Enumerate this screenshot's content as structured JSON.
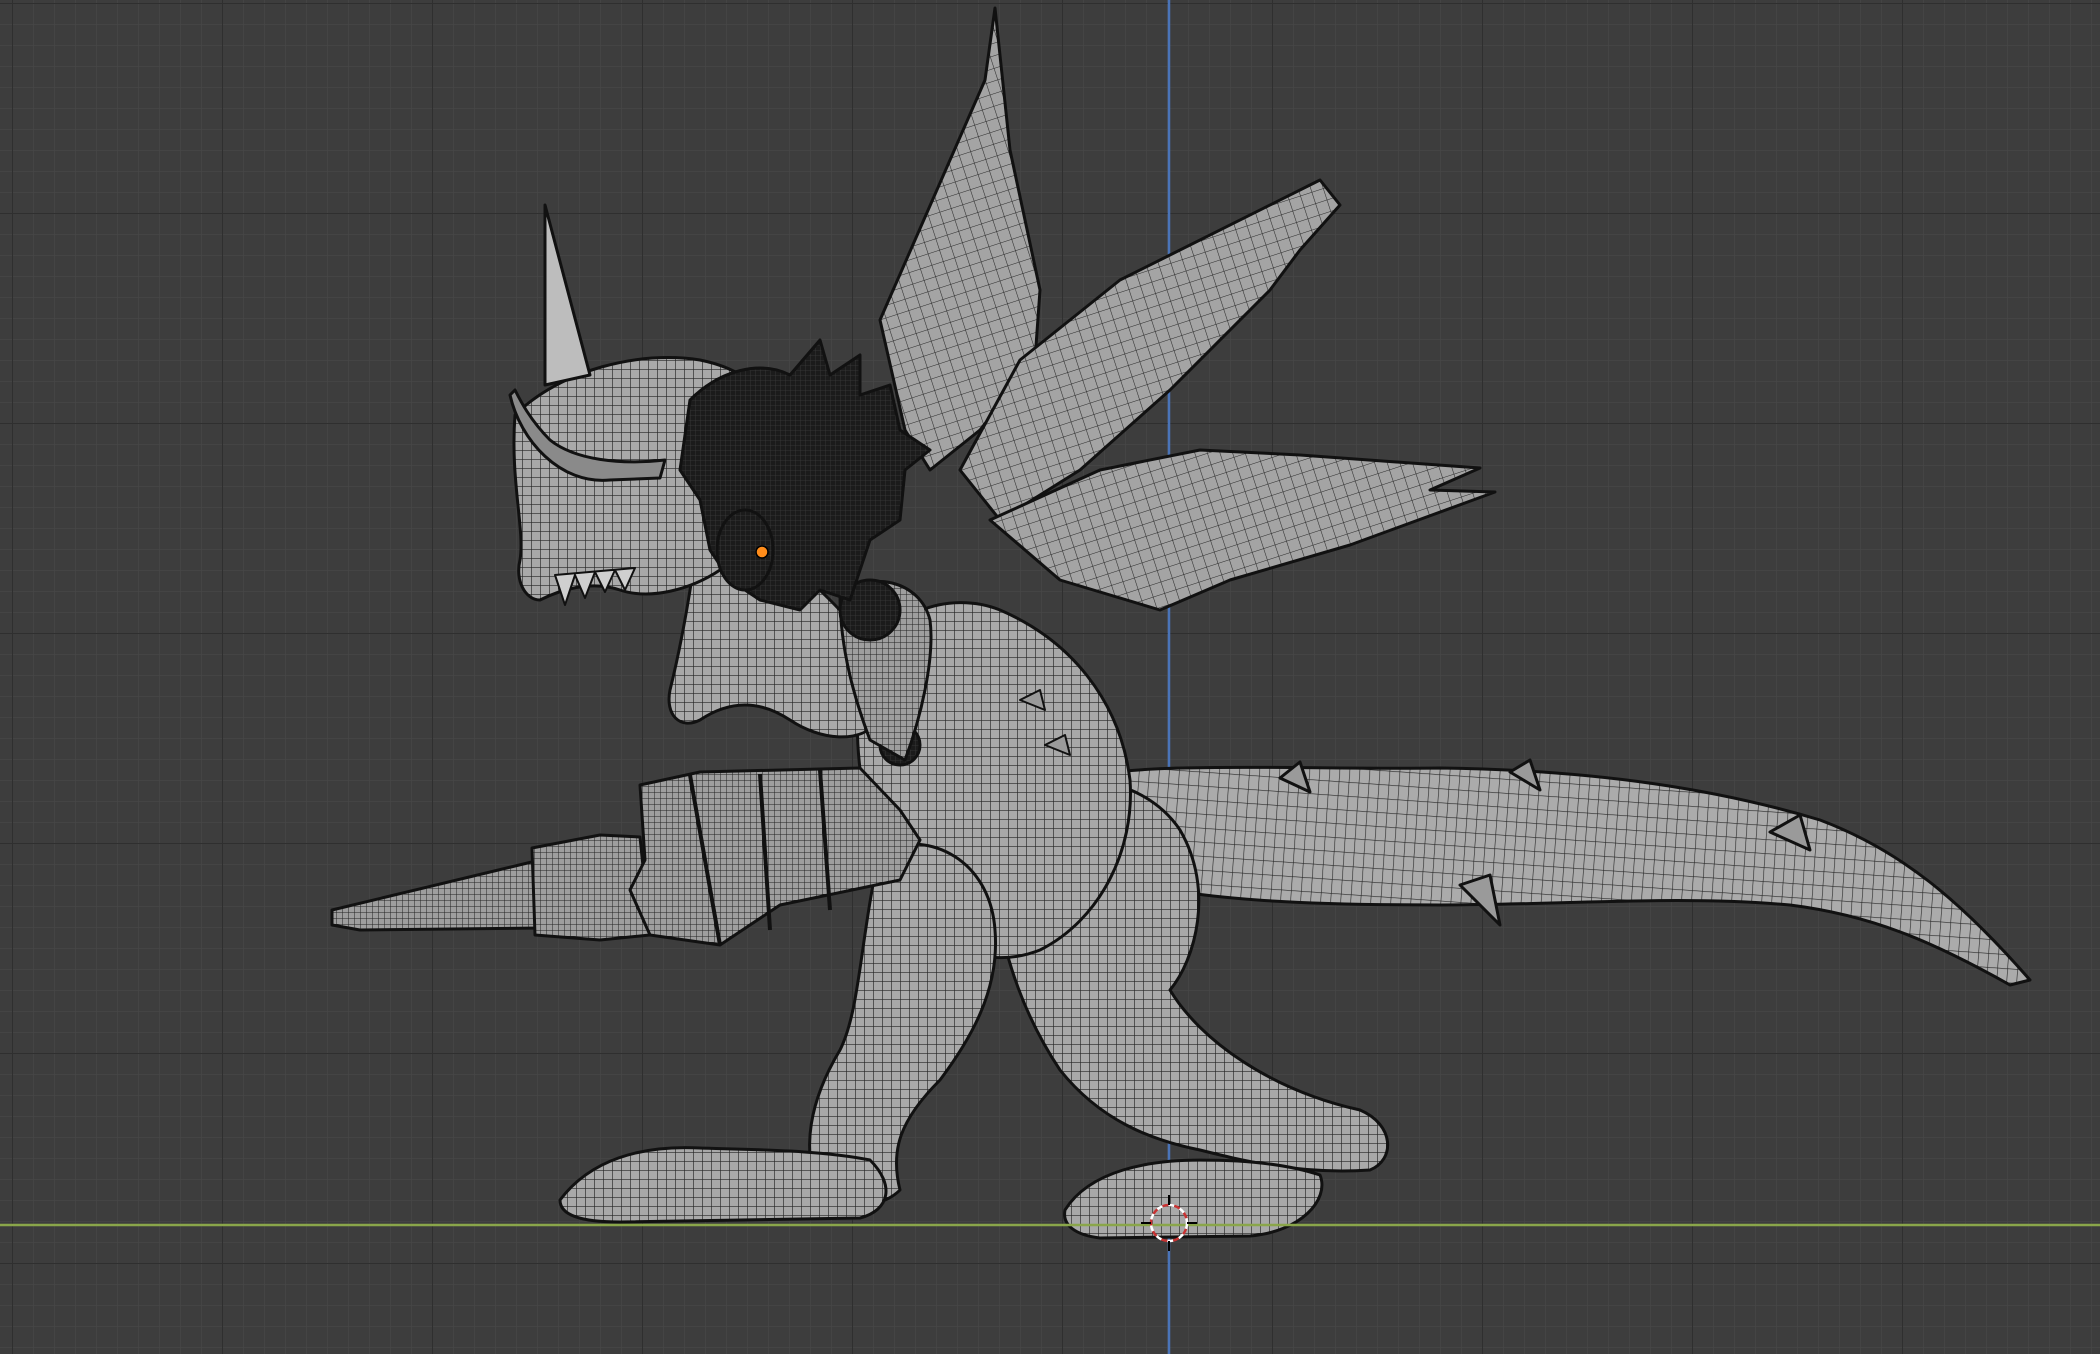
{
  "viewport": {
    "label": "",
    "background_color": "#3d3d3d",
    "grid_minor_color": "#474747",
    "grid_major_color": "#2f2f2f",
    "x_axis_color": "#8aa64a",
    "z_axis_color": "#4a74b8"
  },
  "scene": {
    "object": "dragon",
    "display_mode": "wireframe-over-solid",
    "mesh_fill_color": "#a8a8a8",
    "mesh_line_color": "#1e1e1e",
    "dark_part_color": "#151515",
    "origin_color": "#ff8c1a",
    "cursor_color": "#c83232"
  },
  "icons": {
    "cursor": "3d-cursor-icon",
    "origin": "object-origin-icon"
  }
}
